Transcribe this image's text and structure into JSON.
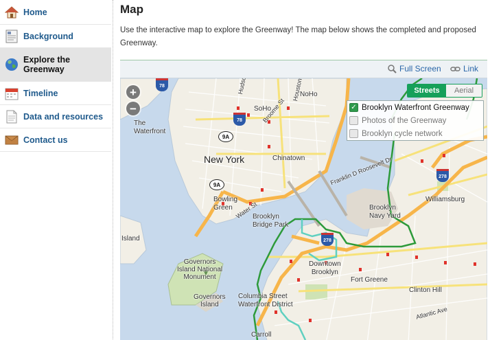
{
  "sidebar": {
    "items": [
      {
        "label": "Home",
        "icon": "house-icon"
      },
      {
        "label": "Background",
        "icon": "document-icon"
      },
      {
        "label": "Explore the Greenway",
        "icon": "globe-icon",
        "active": true
      },
      {
        "label": "Timeline",
        "icon": "calendar-icon"
      },
      {
        "label": "Data and resources",
        "icon": "page-icon"
      },
      {
        "label": "Contact us",
        "icon": "envelope-icon"
      }
    ]
  },
  "content": {
    "title": "Map",
    "intro": "Use the interactive map to explore the Greenway! The map below shows the completed and proposed Greenway."
  },
  "map": {
    "toolbar": {
      "fullscreen_label": "Full Screen",
      "link_label": "Link"
    },
    "zoom_in": "+",
    "zoom_out": "−",
    "view_toggle": {
      "streets": "Streets",
      "aerial": "Aerial",
      "selected": "Streets"
    },
    "layers": [
      {
        "label": "Brooklyn Waterfront Greenway",
        "checked": true
      },
      {
        "label": "Photos of the Greenway",
        "checked": false
      },
      {
        "label": "Brooklyn cycle network",
        "checked": false
      }
    ],
    "labels": {
      "the_waterfront": "The\nWaterfront",
      "new_york": "New York",
      "soho": "SoHo",
      "noho": "NoHo",
      "chinatown": "Chinatown",
      "bowling_green": "Bowling\nGreen",
      "brooklyn_bridge_park": "Brooklyn\nBridge Park",
      "brooklyn_navy_yard": "Brooklyn\nNavy Yard",
      "williamsburg": "Williamsburg",
      "governors_island_nm": "Governors\nIsland National\nMonument",
      "governors_island": "Governors\nIsland",
      "downtown_brooklyn": "Downtown\nBrooklyn",
      "fort_greene": "Fort Greene",
      "columbia_street": "Columbia Street\nWaterfront District",
      "carroll": "Carroll",
      "clinton_hill": "Clinton Hill",
      "island": "Island",
      "hudson_st": "Hudson St",
      "houston_st": "Houston St",
      "broome_st": "Broome St",
      "franklin_d_roosevelt": "Franklin D Roosevelt Dr",
      "water_st": "Water St",
      "atlantic_ave": "Atlantic Ave"
    },
    "shields": {
      "ny9a_top": "9A",
      "ny9a_mid": "9A",
      "i78_a": "78",
      "i78_b": "78",
      "i278_a": "278",
      "i278_b": "278"
    },
    "colors": {
      "water": "#c7d9ec",
      "land": "#f2efe6",
      "park": "#cfe3b5",
      "highway": "#f7b54a",
      "greenway_done": "#2d9a3a",
      "greenway_proposed": "#5fd0c0"
    }
  }
}
